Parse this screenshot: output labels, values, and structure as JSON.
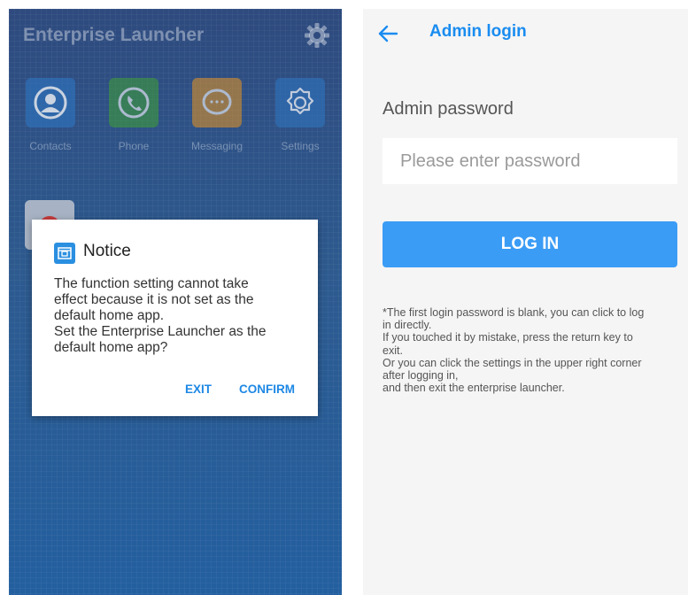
{
  "launcher": {
    "title": "Enterprise Launcher",
    "apps": [
      {
        "label": "Contacts",
        "icon": "contacts-icon",
        "color": "#2f6fb6"
      },
      {
        "label": "Phone",
        "icon": "phone-icon",
        "color": "#3e9b3b"
      },
      {
        "label": "Messaging",
        "icon": "messaging-icon",
        "color": "#d8902a"
      },
      {
        "label": "Settings",
        "icon": "settings-icon",
        "color": "#2f6fb6"
      }
    ]
  },
  "dialog": {
    "title": "Notice",
    "body_lines": [
      "The function setting cannot take",
      "effect because it is not set as the",
      "default home app.",
      "Set the Enterprise Launcher as the",
      "default home app?"
    ],
    "exit_label": "EXIT",
    "confirm_label": "CONFIRM"
  },
  "admin": {
    "title": "Admin login",
    "password_label": "Admin password",
    "password_placeholder": "Please enter password",
    "password_value": "",
    "login_label": "LOG IN",
    "hint_lines": [
      "*The first login password is blank, you can click to log",
      "in directly.",
      " If you touched it by mistake, press the return key to",
      "exit.",
      "Or you can click the settings in the upper right corner",
      "after logging in,",
      "and then exit the enterprise launcher."
    ]
  },
  "colors": {
    "accent": "#1a8cf0",
    "login_button": "#3b9cf5",
    "dialog_button": "#1e88e5"
  }
}
